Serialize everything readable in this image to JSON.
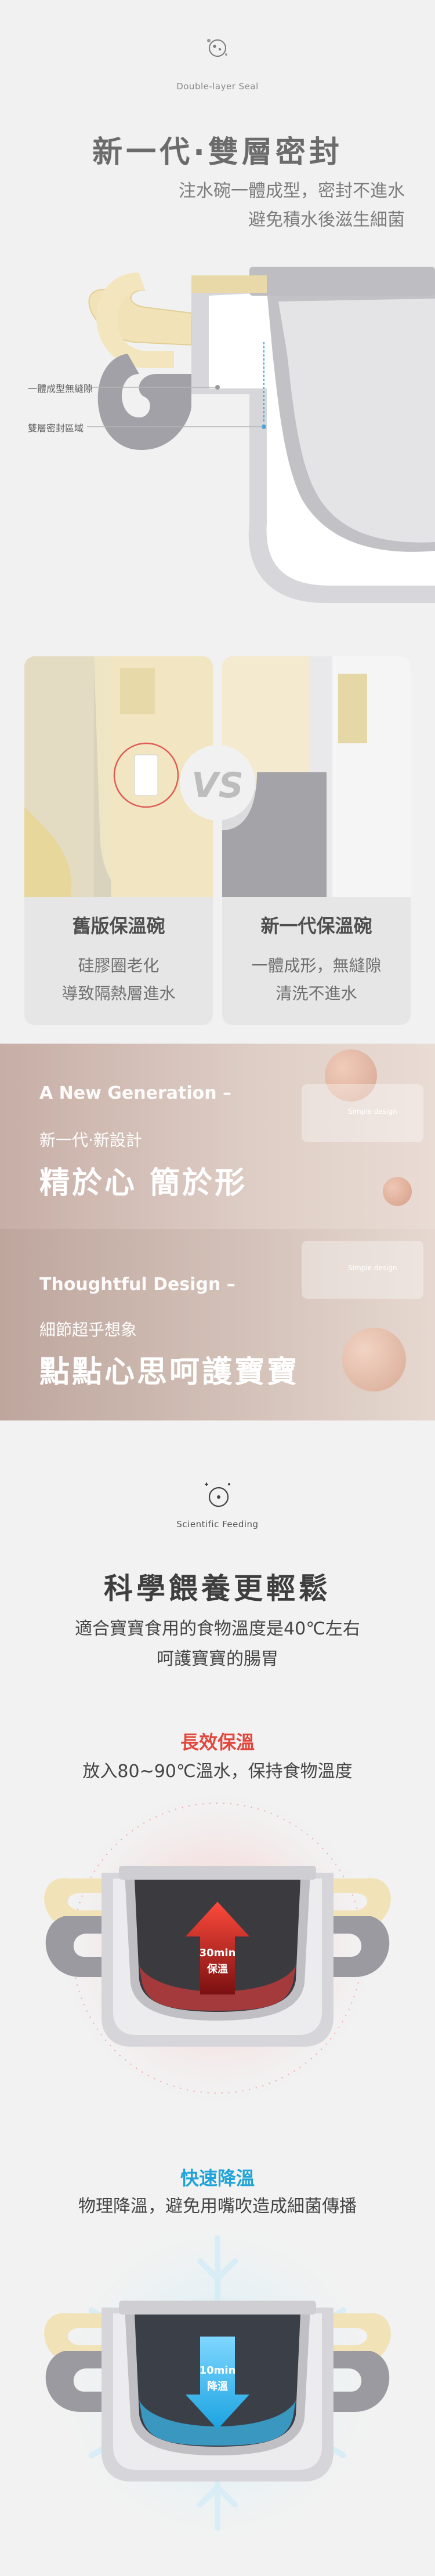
{
  "seal": {
    "icon": "molecule-badge-icon",
    "caption": "Double-layer Seal",
    "title": "新一代·雙層密封",
    "sub1": "注水碗一體成型，密封不進水",
    "sub2": "避免積水後滋生細菌",
    "callout1": "一體成型無縫隙",
    "callout2": "雙層密封區域"
  },
  "compare": {
    "vs": "VS",
    "left_title": "舊版保溫碗",
    "left_text1": "硅膠圈老化",
    "left_text2": "導致隔熱層進水",
    "right_title": "新一代保溫碗",
    "right_text1": "一體成形，無縫隙",
    "right_text2": "清洗不進水"
  },
  "banner1": {
    "en": "A New Generation –",
    "small": "新一代·新設計",
    "big": "精於心 簡於形",
    "tag": "Simple design"
  },
  "banner2": {
    "en": "Thoughtful Design –",
    "small": "細節超乎想象",
    "big": "點點心思呵護寶寶",
    "tag": "Simple design"
  },
  "feed": {
    "icon": "science-badge-icon",
    "caption": "Scientific Feeding",
    "title": "科學餵養更輕鬆",
    "sub1": "適合寶寶食用的食物溫度是40℃左右",
    "sub2": "呵護寶寶的腸胃",
    "warm_title": "長效保溫",
    "warm_text": "放入80~90℃溫水，保持食物溫度",
    "warm_label1": "30min",
    "warm_label2": "保溫",
    "cool_title": "快速降溫",
    "cool_text": "物理降溫，避免用嘴吹造成細菌傳播",
    "cool_label1": "10min",
    "cool_label2": "降溫"
  },
  "colors": {
    "handle_cream": "#f1e2b8",
    "handle_grey": "#9a9aa0",
    "red_accent": "#e2463c",
    "blue_accent": "#1fa3d8"
  }
}
